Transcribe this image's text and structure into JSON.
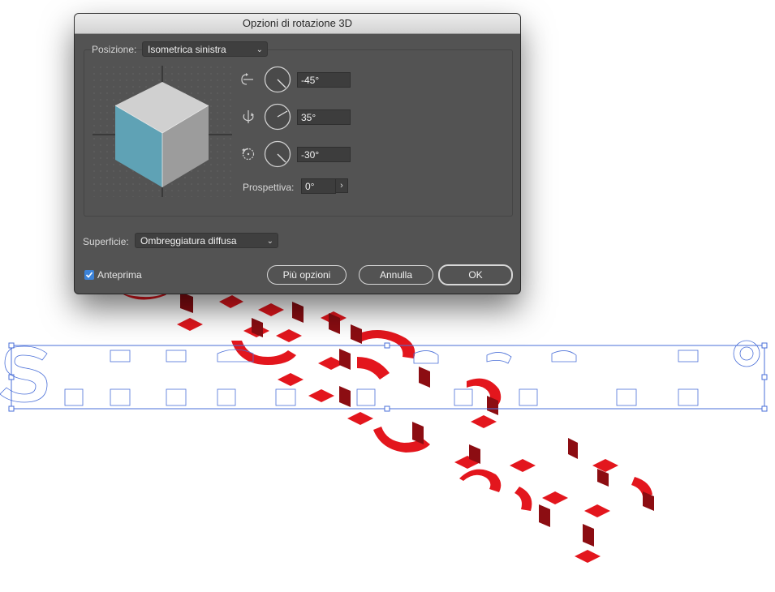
{
  "dialog": {
    "title": "Opzioni di rotazione 3D",
    "position": {
      "label": "Posizione:",
      "value": "Isometrica sinistra"
    },
    "rotation": {
      "x_value": "-45°",
      "y_value": "35°",
      "z_value": "-30°"
    },
    "perspective": {
      "label": "Prospettiva:",
      "value": "0°",
      "stepper": "›"
    },
    "surface": {
      "label": "Superficie:",
      "value": "Ombreggiatura diffusa"
    },
    "preview": {
      "label": "Anteprima",
      "checked": true
    },
    "buttons": {
      "more": "Più opzioni",
      "cancel": "Annulla",
      "ok": "OK"
    }
  },
  "colors": {
    "dialog_bg": "#535353",
    "accent_blue": "#3b82d8",
    "cube_top": "#d0d0d0",
    "cube_left": "#5fa2b5",
    "cube_right": "#9c9c9c",
    "artwork_red": "#e3161d",
    "artwork_dark_red": "#8c0d12",
    "selection_blue": "#4a6fd8"
  },
  "icons": [
    "x-axis-rotation-icon",
    "y-axis-rotation-icon",
    "z-axis-rotation-icon",
    "dial-icon",
    "chevron-down-icon",
    "checkmark-icon"
  ]
}
